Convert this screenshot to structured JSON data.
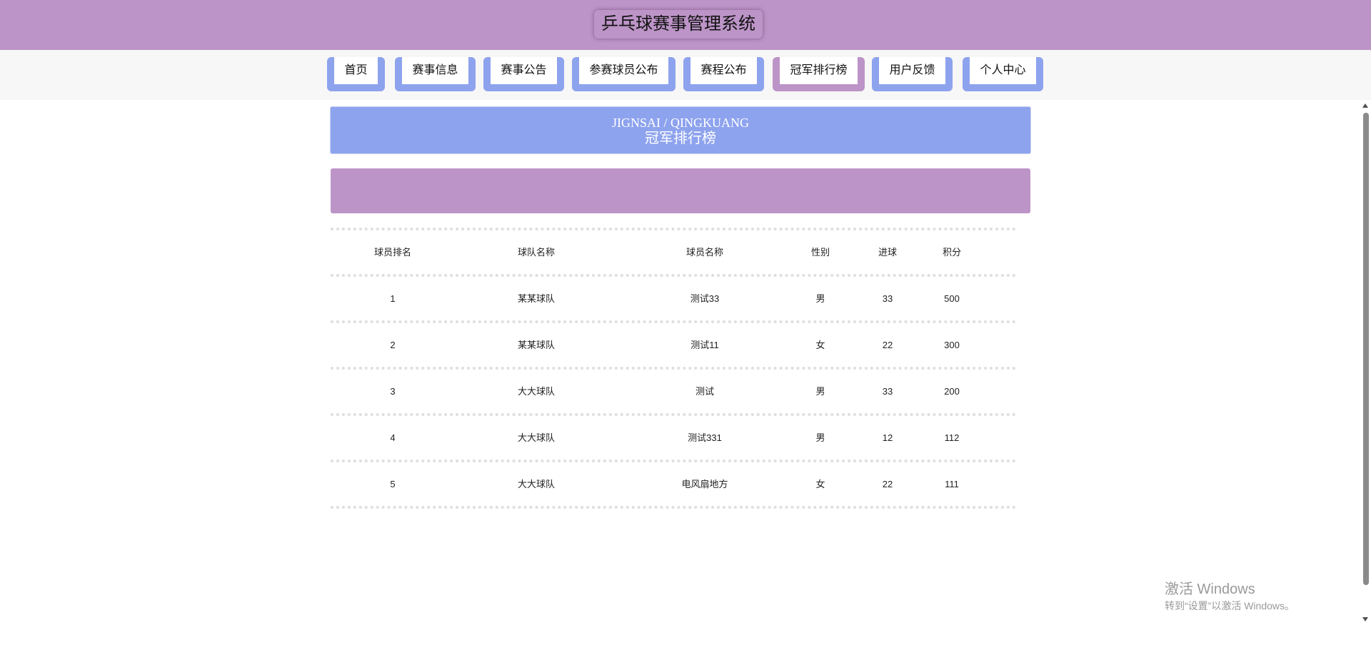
{
  "header": {
    "title": "乒乓球赛事管理系统"
  },
  "nav": {
    "items": [
      {
        "label": "首页"
      },
      {
        "label": "赛事信息"
      },
      {
        "label": "赛事公告"
      },
      {
        "label": "参赛球员公布"
      },
      {
        "label": "赛程公布"
      },
      {
        "label": "冠军排行榜"
      },
      {
        "label": "用户反馈"
      },
      {
        "label": "个人中心"
      }
    ],
    "active_index": 5
  },
  "banner": {
    "subtitle_en": "JIGNSAI / QINGKUANG",
    "title": "冠军排行榜"
  },
  "table": {
    "columns": [
      "球员排名",
      "球队名称",
      "球员名称",
      "性别",
      "进球",
      "积分"
    ],
    "rows": [
      [
        "1",
        "某某球队",
        "测试33",
        "男",
        "33",
        "500"
      ],
      [
        "2",
        "某某球队",
        "测试11",
        "女",
        "22",
        "300"
      ],
      [
        "3",
        "大大球队",
        "测试",
        "男",
        "33",
        "200"
      ],
      [
        "4",
        "大大球队",
        "测试331",
        "男",
        "12",
        "112"
      ],
      [
        "5",
        "大大球队",
        "电风扇地方",
        "女",
        "22",
        "111"
      ]
    ]
  },
  "watermark": {
    "line1": "激活 Windows",
    "line2": "转到“设置”以激活 Windows。"
  },
  "colors": {
    "header_bg": "#bc94c7",
    "nav_accent": "#8ea3ee",
    "nav_active": "#bc94c7",
    "banner_bg": "#8ea3ee"
  }
}
